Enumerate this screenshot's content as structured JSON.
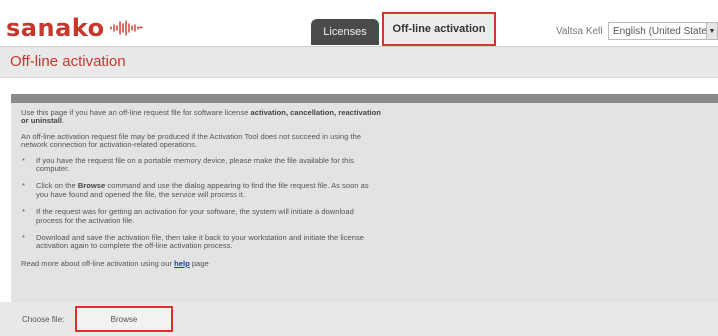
{
  "brand": {
    "logo_text": "sanako",
    "logo_icon": "sound-wave-icon"
  },
  "tabs": [
    {
      "label": "Licenses",
      "active": false
    },
    {
      "label": "Off-line activation",
      "active": true
    }
  ],
  "user": {
    "name": "Valtsa Kell"
  },
  "language": {
    "selected": "English (United States)"
  },
  "page": {
    "title": "Off-line activation"
  },
  "content": {
    "intro_prefix": "Use this page if you have an off-line request file for software license ",
    "intro_bold": "activation, cancellation, reactivation or uninstall",
    "intro_suffix": ".",
    "note": "An off-line activation request file may be produced if the Activation Tool does not succeed in using the network connection for activation-related operations.",
    "bullet_mark": "*",
    "bullet1": "If you have the request file on a portable memory device, please make the file available for this computer.",
    "bullet2_prefix": "Click on the ",
    "bullet2_bold": "Browse",
    "bullet2_suffix": " command and use the dialog appearing to find the file request file. As soon as you have found and opened the file, the service will process it.",
    "bullet3": "If the request was for getting an activation for your software, the system will initiate a download process for the activation file.",
    "bullet4": "Download and save the activation file, then take it back to your workstation and initiate the license activation again to complete the off-line activation process.",
    "read_more_prefix": "Read more about off-line activation using our ",
    "help_link": "help",
    "read_more_suffix": " page"
  },
  "file_picker": {
    "label": "Choose file:",
    "button": "Browse"
  },
  "colors": {
    "brand": "#c8372d",
    "highlight_border": "#d9332c",
    "dark_tab": "#4a4a4a",
    "link": "#1a3d9c"
  }
}
